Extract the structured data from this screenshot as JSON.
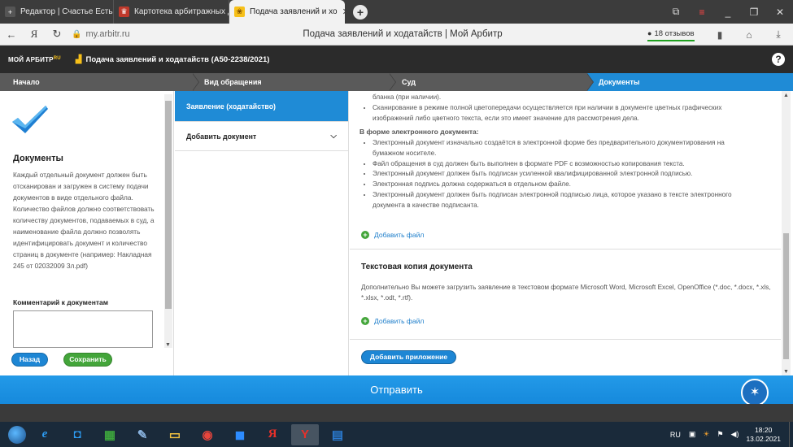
{
  "browser": {
    "tabs": [
      {
        "label": "Редактор | Счастье Есть!"
      },
      {
        "label": "Картотека арбитражных д"
      },
      {
        "label": "Подача заявлений и хо"
      }
    ],
    "url": "my.arbitr.ru",
    "page_title": "Подача заявлений и ходатайств | Мой Арбитр",
    "reviews": "18 отзывов"
  },
  "header": {
    "logo_main": "МОЙ АРБИТР",
    "logo_sup": "RU",
    "case_title": "Подача заявлений и ходатайств  (А50-2238/2021)",
    "help": "?"
  },
  "steps": [
    "Начало",
    "Вид обращения",
    "Суд",
    "Документы"
  ],
  "sidebar": {
    "heading": "Документы",
    "description": "Каждый отдельный документ должен быть отсканирован и загружен в систему подачи документов в виде отдельного файла. Количество файлов должно соответствовать количеству документов, подаваемых в суд, а наименование файла должно позволять идентифицировать документ и количество страниц в документе (например: Накладная 245 от 02032009 3л.pdf)",
    "comment_label": "Комментарий к документам",
    "back_label": "Назад",
    "save_label": "Сохранить"
  },
  "doclist": {
    "items": [
      {
        "label": "Заявление (ходатайство)"
      },
      {
        "label": "Добавить документ"
      }
    ]
  },
  "content": {
    "scan_rules": [
      "бланка (при наличии).",
      "Сканирование в режиме полной цветопередачи осуществляется при наличии в документе цветных графических изображений либо цветного текста, если это имеет значение для рассмотрения дела."
    ],
    "electronic_heading": "В форме электронного документа:",
    "electronic_rules": [
      "Электронный документ изначально создаётся в электронной форме без предварительного документирования на бумажном носителе.",
      "Файл обращения в суд должен быть выполнен в формате PDF с возможностью копирования текста.",
      "Электронный документ должен быть подписан усиленной квалифицированной электронной подписью.",
      "Электронная подпись должна содержаться в отдельном файле.",
      "Электронный документ должен быть подписан электронной подписью лица, которое указано в тексте электронного документа в качестве подписанта."
    ],
    "add_file_label": "Добавить файл",
    "text_copy_heading": "Текстовая копия документа",
    "text_copy_desc": "Дополнительно Вы можете загрузить заявление в текстовом формате Microsoft Word, Microsoft Excel, OpenOffice (*.doc, *.docx, *.xls, *.xlsx, *.odt, *.rtf).",
    "add_file_label_2": "Добавить файл",
    "add_attachment_label": "Добавить приложение"
  },
  "submit_label": "Отправить",
  "taskbar": {
    "lang": "RU",
    "time": "18:20",
    "date": "13.02.2021"
  },
  "colors": {
    "accent_blue": "#1f8bd6",
    "save_green": "#43a53a",
    "header_dark": "#2b2b2b",
    "logo_yellow": "#f7c019"
  }
}
